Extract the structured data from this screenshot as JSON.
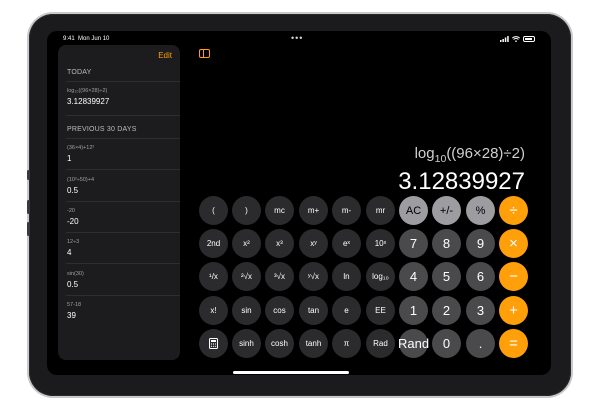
{
  "status_bar": {
    "time": "9:41",
    "date": "Mon Jun 10",
    "dots": "•••",
    "battery": "100%"
  },
  "history": {
    "edit_label": "Edit",
    "today_title": "TODAY",
    "today_items": [
      {
        "expression": "log₁₀((96×28)÷2)",
        "result": "3.12839927"
      }
    ],
    "previous_title": "PREVIOUS 30 DAYS",
    "previous_items": [
      {
        "expression": "(36×4)+12²",
        "result": "1"
      },
      {
        "expression": "(10²÷50)+4",
        "result": "0.5"
      },
      {
        "expression": "-20",
        "result": "-20"
      },
      {
        "expression": "12÷3",
        "result": "4"
      },
      {
        "expression": "sin(30)",
        "result": "0.5"
      },
      {
        "expression": "57-18",
        "result": "39"
      }
    ]
  },
  "calculator": {
    "expression": "log10((96×28)÷2)",
    "display": "3.12839927",
    "keys": [
      [
        "(",
        ")",
        "mc",
        "m+",
        "m-",
        "mr",
        "AC",
        "+/-",
        "%",
        "÷"
      ],
      [
        "2nd",
        "x²",
        "x³",
        "xʸ",
        "eˣ",
        "10ˣ",
        "7",
        "8",
        "9",
        "×"
      ],
      [
        "¹/x",
        "²√x",
        "³√x",
        "ʸ√x",
        "ln",
        "log₁₀",
        "4",
        "5",
        "6",
        "−"
      ],
      [
        "x!",
        "sin",
        "cos",
        "tan",
        "e",
        "EE",
        "1",
        "2",
        "3",
        "+"
      ],
      [
        "calculator-icon",
        "sinh",
        "cosh",
        "tanh",
        "π",
        "Rad",
        "Rand",
        "0",
        ".",
        "="
      ]
    ]
  },
  "colors": {
    "accent": "#ff9f0a",
    "function_key": "#2b2b2d",
    "number_key": "#4a4a4d",
    "utility_key": "#9c9ca1",
    "background": "#000000"
  }
}
